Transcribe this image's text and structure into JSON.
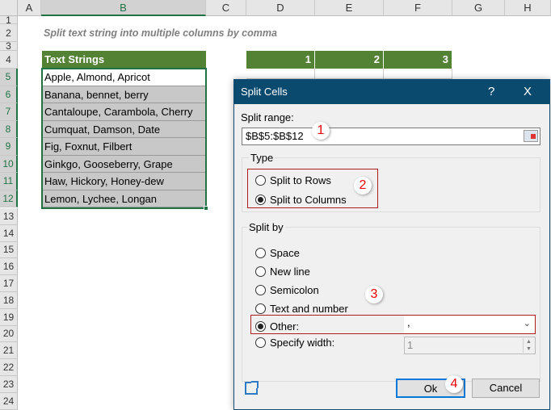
{
  "sheet": {
    "columns": [
      "A",
      "B",
      "C",
      "D",
      "E",
      "F",
      "G",
      "H"
    ],
    "rows": [
      "1",
      "2",
      "3",
      "4",
      "5",
      "6",
      "7",
      "8",
      "9",
      "10",
      "11",
      "12",
      "13",
      "14",
      "15",
      "16",
      "17",
      "18",
      "19",
      "20",
      "21",
      "22",
      "23",
      "24"
    ],
    "title": "Split text string into multiple columns by comma",
    "header": "Text Strings",
    "strings": [
      "Apple, Almond, Apricot",
      "Banana, bennet, berry",
      "Cantaloupe, Carambola, Cherry",
      "Cumquat, Damson, Date",
      "Fig, Foxnut, Filbert",
      "Ginkgo, Gooseberry, Grape",
      "Haw, Hickory, Honey-dew",
      "Lemon, Lychee, Longan"
    ],
    "result_headers": [
      "1",
      "2",
      "3"
    ],
    "accent": "#548235"
  },
  "dialog": {
    "title": "Split Cells",
    "help": "?",
    "close": "X",
    "range_label": "Split range:",
    "range_value": "$B$5:$B$12",
    "type_label": "Type",
    "type_options": [
      {
        "label": "Split to Rows",
        "checked": false
      },
      {
        "label": "Split to Columns",
        "checked": true
      }
    ],
    "splitby_label": "Split by",
    "splitby_options": [
      {
        "label": "Space",
        "checked": false
      },
      {
        "label": "New line",
        "checked": false
      },
      {
        "label": "Semicolon",
        "checked": false
      },
      {
        "label": "Text and number",
        "checked": false
      },
      {
        "label": "Other:",
        "checked": true
      },
      {
        "label": "Specify width:",
        "checked": false
      }
    ],
    "other_value": ",",
    "width_value": "1",
    "ok": "Ok",
    "cancel": "Cancel",
    "steps": [
      "1",
      "2",
      "3",
      "4"
    ],
    "title_color": "#0b4a6f",
    "highlight_color": "#c00000"
  }
}
